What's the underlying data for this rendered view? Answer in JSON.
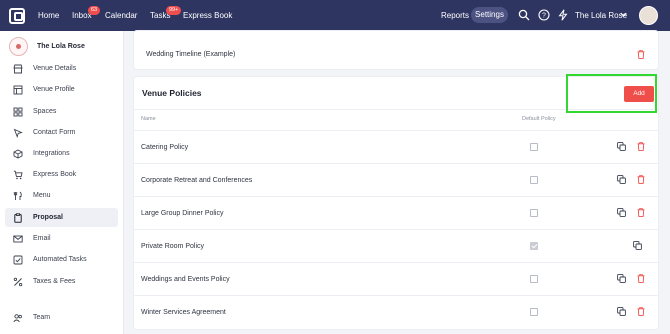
{
  "topnav": {
    "links": [
      "Home",
      "Inbox",
      "Calendar",
      "Tasks",
      "Express Book"
    ],
    "inbox_badge": "63",
    "tasks_badge": "99+",
    "reports": "Reports",
    "settings": "Settings",
    "account": "The Lola Rose",
    "colors": {
      "bar": "#2e3561",
      "badge": "#f04e4e"
    }
  },
  "sidebar": {
    "venue_name": "The Lola Rose",
    "items": [
      {
        "label": "Venue Details",
        "icon": "storefront-icon"
      },
      {
        "label": "Venue Profile",
        "icon": "profile-card-icon"
      },
      {
        "label": "Spaces",
        "icon": "grid-icon"
      },
      {
        "label": "Contact Form",
        "icon": "cursor-icon"
      },
      {
        "label": "Integrations",
        "icon": "cube-icon"
      },
      {
        "label": "Express Book",
        "icon": "cart-icon"
      },
      {
        "label": "Menu",
        "icon": "utensils-icon"
      },
      {
        "label": "Proposal",
        "icon": "clipboard-icon"
      },
      {
        "label": "Email",
        "icon": "envelope-icon"
      },
      {
        "label": "Automated Tasks",
        "icon": "checkbox-icon"
      },
      {
        "label": "Taxes & Fees",
        "icon": "percent-icon"
      },
      {
        "label": "Team",
        "icon": "people-icon"
      }
    ],
    "active": "Proposal"
  },
  "timeline": {
    "label": "Wedding Timeline (Example)"
  },
  "policies": {
    "title": "Venue Policies",
    "add_label": "Add",
    "columns": {
      "name": "Name",
      "default": "Default Policy"
    },
    "rows": [
      {
        "name": "Catering Policy",
        "default": false
      },
      {
        "name": "Corporate Retreat and Conferences",
        "default": false
      },
      {
        "name": "Large Group Dinner Policy",
        "default": false
      },
      {
        "name": "Private Room Policy",
        "default": true
      },
      {
        "name": "Weddings and Events Policy",
        "default": false
      },
      {
        "name": "Winter Services Agreement",
        "default": false
      }
    ],
    "colors": {
      "accent": "#ef4e4b",
      "highlight": "#32d72f"
    }
  }
}
